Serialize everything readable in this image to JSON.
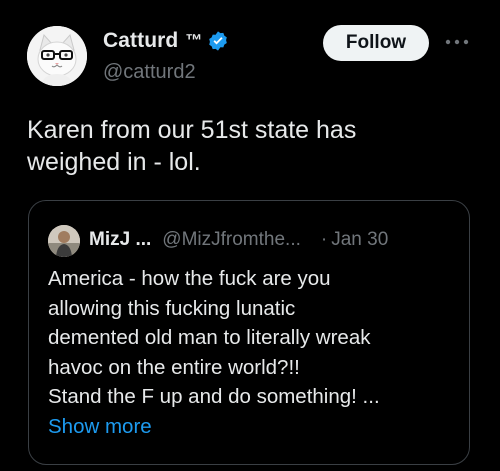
{
  "author": {
    "display_name": "Catturd",
    "trademark": "™",
    "handle": "@catturd2",
    "avatar_icon": "cat-with-glasses-avatar",
    "verified_icon": "verified-badge-icon"
  },
  "actions": {
    "follow_label": "Follow",
    "more_icon": "more-dots-icon"
  },
  "tweet": {
    "lines": [
      "Karen from our 51st state has",
      "weighed in - lol."
    ]
  },
  "quote": {
    "display_name": "MizJ ...",
    "handle": "@MizJfromthe...",
    "separator": "·",
    "date": "Jan 30",
    "lines": [
      "America - how the fuck are you",
      "allowing this fucking lunatic",
      "demented old man to literally wreak",
      "havoc on the entire world?!!",
      "Stand the F up and do something! ..."
    ],
    "show_more_label": "Show more"
  },
  "colors": {
    "background": "#000000",
    "text_primary": "#e7e9ea",
    "text_secondary": "#71767b",
    "accent": "#1d9bf0",
    "border": "#3a3f44"
  }
}
